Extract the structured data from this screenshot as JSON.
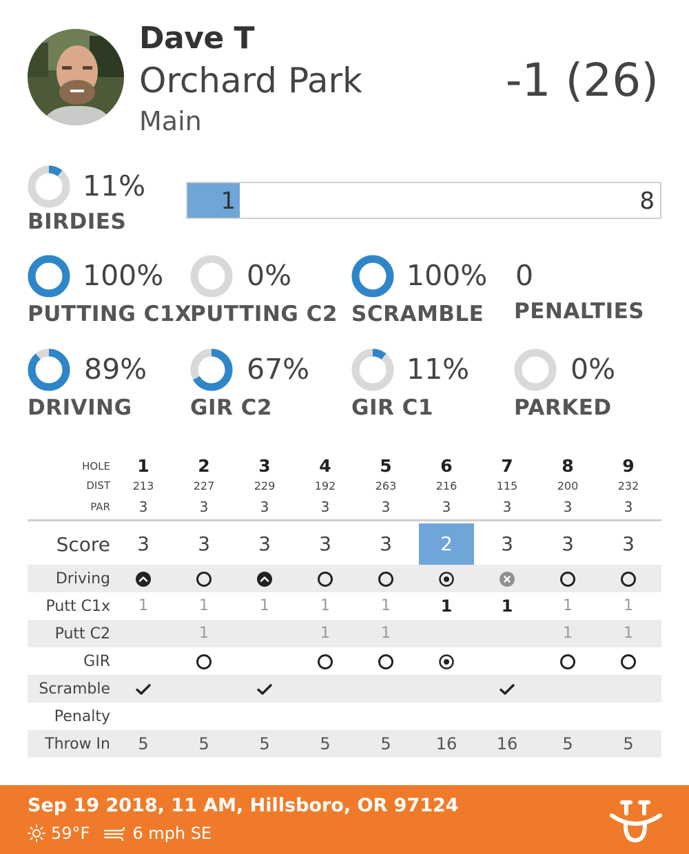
{
  "header": {
    "player_name": "Dave T",
    "course_name": "Orchard Park",
    "layout_name": "Main",
    "total_score": "-1 (26)"
  },
  "birdies": {
    "percent_text": "11%",
    "percent": 0.11,
    "label": "BIRDIES",
    "bar_filled": "1",
    "bar_total": "8",
    "bar_fraction": 0.111
  },
  "stats": [
    {
      "key": "putting-c1x",
      "percent_text": "100%",
      "percent": 1.0,
      "label": "PUTTING C1X"
    },
    {
      "key": "putting-c2",
      "percent_text": "0%",
      "percent": 0.0,
      "label": "PUTTING C2"
    },
    {
      "key": "scramble",
      "percent_text": "100%",
      "percent": 1.0,
      "label": "SCRAMBLE"
    },
    {
      "key": "penalties",
      "value_text": "0",
      "label": "PENALTIES"
    },
    {
      "key": "driving",
      "percent_text": "89%",
      "percent": 0.89,
      "label": "DRIVING"
    },
    {
      "key": "gir-c2",
      "percent_text": "67%",
      "percent": 0.67,
      "label": "GIR C2"
    },
    {
      "key": "gir-c1",
      "percent_text": "11%",
      "percent": 0.11,
      "label": "GIR C1"
    },
    {
      "key": "parked",
      "percent_text": "0%",
      "percent": 0.0,
      "label": "PARKED"
    }
  ],
  "scorecard": {
    "header_labels": {
      "hole": "HOLE",
      "dist": "DIST",
      "par": "PAR"
    },
    "holes": [
      "1",
      "2",
      "3",
      "4",
      "5",
      "6",
      "7",
      "8",
      "9"
    ],
    "dist": [
      "213",
      "227",
      "229",
      "192",
      "263",
      "216",
      "115",
      "200",
      "232"
    ],
    "par": [
      "3",
      "3",
      "3",
      "3",
      "3",
      "3",
      "3",
      "3",
      "3"
    ],
    "row_labels": {
      "score": "Score",
      "driving": "Driving",
      "putt_c1x": "Putt C1x",
      "putt_c2": "Putt C2",
      "gir": "GIR",
      "scramble": "Scramble",
      "penalty": "Penalty",
      "throw_in": "Throw In"
    },
    "score": [
      "3",
      "3",
      "3",
      "3",
      "3",
      "2",
      "3",
      "3",
      "3"
    ],
    "highlighted_hole_index": 5,
    "driving": [
      "up",
      "ring",
      "up",
      "ring",
      "ring",
      "dot",
      "x",
      "ring",
      "ring"
    ],
    "putt_c1x": [
      "1",
      "1",
      "1",
      "1",
      "1",
      "1",
      "1",
      "1",
      "1"
    ],
    "putt_c1x_bold": [
      false,
      false,
      false,
      false,
      false,
      true,
      true,
      false,
      false
    ],
    "putt_c2": [
      "",
      "1",
      "",
      "1",
      "1",
      "",
      "",
      "1",
      "1"
    ],
    "gir": [
      "",
      "ring",
      "",
      "ring",
      "ring",
      "dot",
      "",
      "ring",
      "ring"
    ],
    "scramble": [
      true,
      false,
      true,
      false,
      false,
      false,
      true,
      false,
      false
    ],
    "penalty": [
      "",
      "",
      "",
      "",
      "",
      "",
      "",
      "",
      ""
    ],
    "throw_in": [
      "5",
      "5",
      "5",
      "5",
      "5",
      "16",
      "16",
      "5",
      "5"
    ]
  },
  "footer": {
    "info": "Sep 19 2018, 11 AM, Hillsboro, OR 97124",
    "temperature": "59°F",
    "wind": "6 mph SE",
    "weather_icon": "sun-icon",
    "wind_icon": "wind-icon",
    "accent_color": "#ef7b2a"
  },
  "colors": {
    "ring_fill": "#2e86c9",
    "ring_track": "#d9d9d9",
    "highlight": "#6fa5d8"
  }
}
